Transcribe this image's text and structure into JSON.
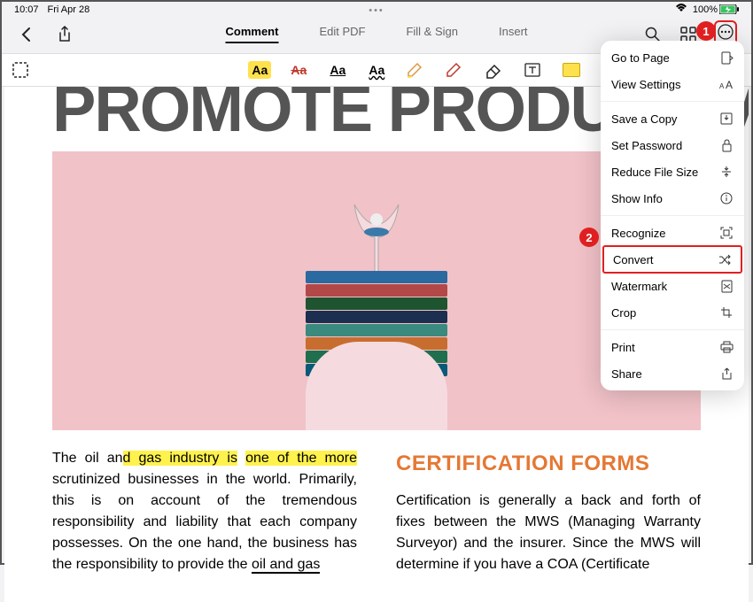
{
  "status": {
    "time": "10:07",
    "date": "Fri Apr 28",
    "battery": "100%"
  },
  "appbar": {
    "tabs": [
      "Comment",
      "Edit PDF",
      "Fill & Sign",
      "Insert"
    ],
    "activeTab": 0
  },
  "callouts": {
    "one": "1",
    "two": "2"
  },
  "menu": {
    "groups": [
      [
        {
          "label": "Go to Page",
          "icon": "goto"
        },
        {
          "label": "View Settings",
          "icon": "text-size"
        }
      ],
      [
        {
          "label": "Save a Copy",
          "icon": "save"
        },
        {
          "label": "Set Password",
          "icon": "lock"
        },
        {
          "label": "Reduce File Size",
          "icon": "compress"
        },
        {
          "label": "Show Info",
          "icon": "info"
        }
      ],
      [
        {
          "label": "Recognize",
          "icon": "scan"
        },
        {
          "label": "Convert",
          "icon": "shuffle",
          "highlight": true
        },
        {
          "label": "Watermark",
          "icon": "watermark"
        },
        {
          "label": "Crop",
          "icon": "crop"
        }
      ],
      [
        {
          "label": "Print",
          "icon": "print"
        },
        {
          "label": "Share",
          "icon": "share"
        }
      ]
    ]
  },
  "document": {
    "headline": "PROMOTE PRODUCTIV",
    "col1": {
      "pre": "The oil an",
      "hl1": "d gas industry is",
      "mid": " ",
      "hl2": "one of the more",
      "post1": " scrutinized businesses in the world. Primarily, this is on account of the tremendous responsibility and liability that each company possesses. On the one hand, the business has the responsibility to provide the ",
      "strike": "oil and gas"
    },
    "col2": {
      "heading": "CERTIFICATION FORMS",
      "body": "Certification is generally a back and forth of fixes between the MWS (Managing Warranty Surveyor) and the insurer. Since the MWS will determine if you have a COA (Certificate"
    }
  },
  "colors": {
    "accentRed": "#e02020",
    "highlightYellow": "#fff24d",
    "headingOrange": "#e57834"
  }
}
